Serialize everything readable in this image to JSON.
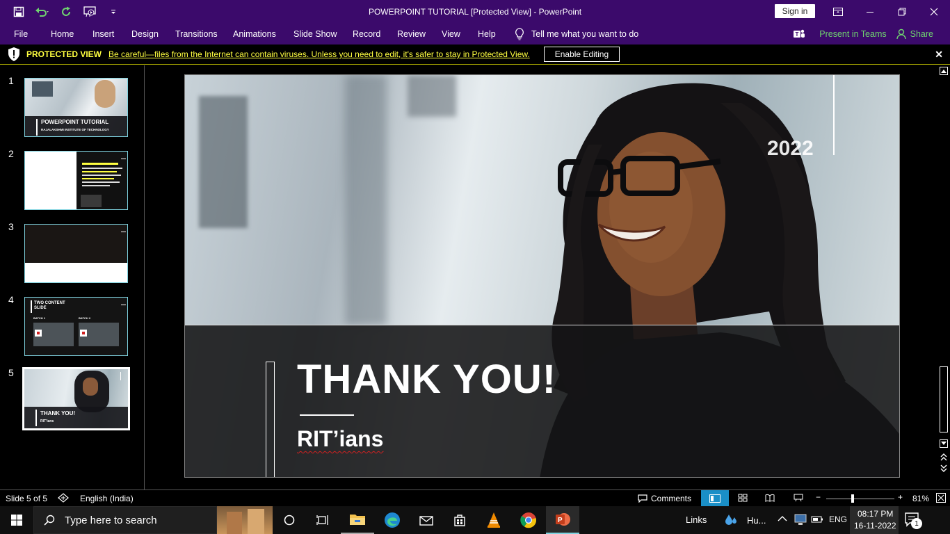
{
  "window": {
    "title": "POWERPOINT TUTORIAL [Protected View]  -  PowerPoint",
    "sign_in": "Sign in"
  },
  "ribbon": {
    "tabs": [
      "File",
      "Home",
      "Insert",
      "Design",
      "Transitions",
      "Animations",
      "Slide Show",
      "Record",
      "Review",
      "View",
      "Help"
    ],
    "tell_me": "Tell me what you want to do",
    "present_in_teams": "Present in Teams",
    "share": "Share"
  },
  "protected_view": {
    "label": "PROTECTED VIEW",
    "message": "Be careful—files from the Internet can contain viruses. Unless you need to edit, it's safer to stay in Protected View.",
    "enable_button": "Enable Editing"
  },
  "thumbnails": [
    {
      "number": "1",
      "title": "POWERPOINT TUTORIAL",
      "subtitle": "RAJALAKSHMI INSTITUTE OF TECHNOLOGY"
    },
    {
      "number": "2"
    },
    {
      "number": "3"
    },
    {
      "number": "4",
      "title": "TWO CONTENT SLIDE",
      "left": "BATCH 1",
      "right": "BATCH 2"
    },
    {
      "number": "5",
      "title": "THANK YOU!",
      "subtitle": "RIT'ians",
      "selected": true
    }
  ],
  "slide": {
    "title": "THANK YOU!",
    "subtitle": "RIT’ians",
    "year": "2022"
  },
  "status": {
    "slide_counter": "Slide 5 of 5",
    "language": "English (India)",
    "comments": "Comments",
    "zoom": "81%"
  },
  "taskbar": {
    "search_placeholder": "Type here to search",
    "links": "Links",
    "weather": "Hu...",
    "lang": "ENG",
    "time": "08:17 PM",
    "date": "16-11-2022",
    "notification_count": "1"
  },
  "colors": {
    "ribbon_bg": "#3b0a6b",
    "pv_text": "#ffff40",
    "accent_teams": "#6fd36f",
    "thumb_border": "#7fd3e0"
  }
}
